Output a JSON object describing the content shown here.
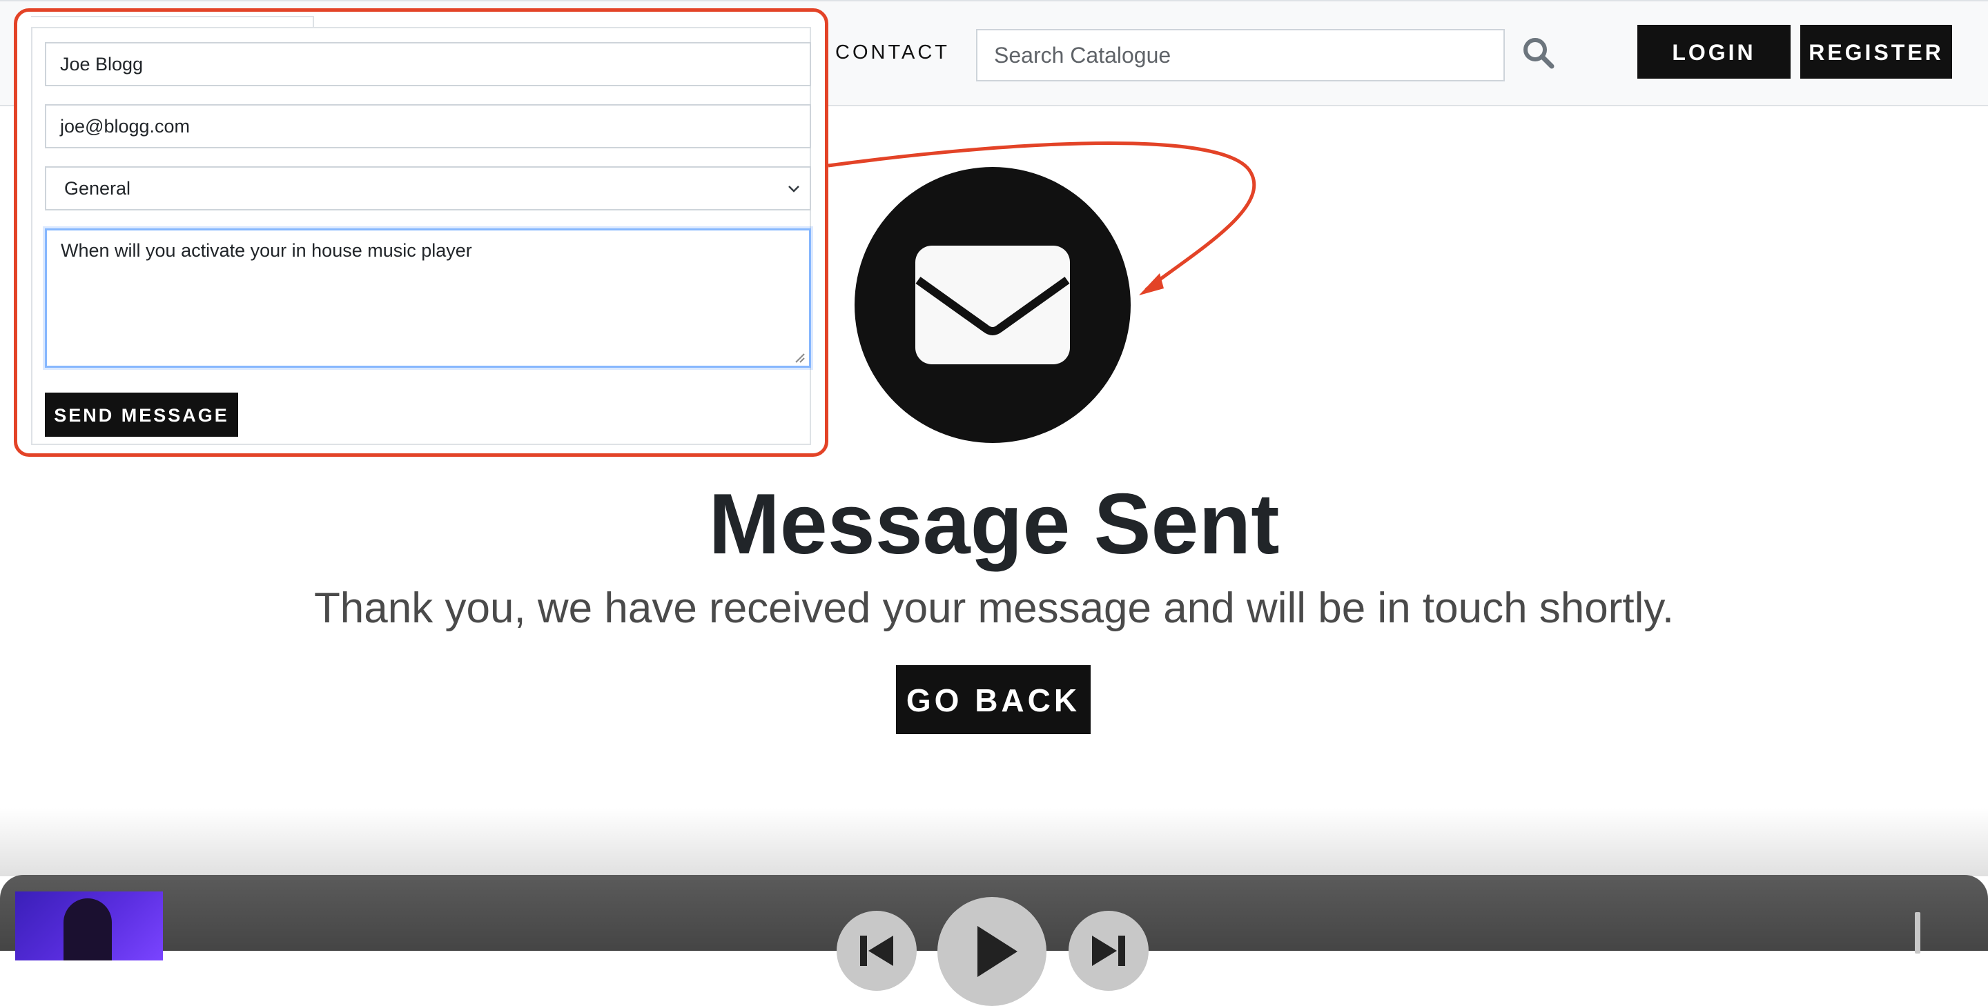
{
  "nav": {
    "contact_label": "CONTACT",
    "search_placeholder": "Search Catalogue",
    "search_icon": "search-icon",
    "login_label": "LOGIN",
    "register_label": "REGISTER"
  },
  "main": {
    "icon": "envelope-icon",
    "title": "Message Sent",
    "subtitle": "Thank you, we have received your message and will be in touch shortly.",
    "go_back_label": "GO BACK"
  },
  "contact_form": {
    "name_value": "Joe Blogg",
    "email_value": "joe@blogg.com",
    "topic_value": "General",
    "message_value": "When will you activate your in house music player",
    "send_label": "SEND MESSAGE"
  },
  "annotation": {
    "color": "#e34327"
  },
  "player": {
    "prev_icon": "skip-previous-icon",
    "play_icon": "play-icon",
    "next_icon": "skip-next-icon"
  },
  "colors": {
    "button_bg": "#111111",
    "focus_border": "#86b7fe",
    "nav_bg": "#f8f9fa",
    "player_bg": "#4d4d4d"
  }
}
